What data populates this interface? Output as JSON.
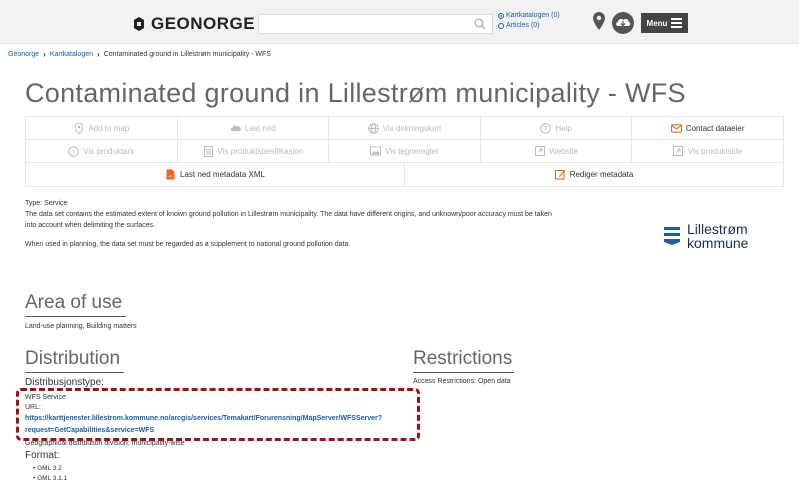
{
  "header": {
    "logo_text": "GEONORGE",
    "search_placeholder": "",
    "radio_options": [
      "Kartkatalogen (0)",
      "Articles (0)"
    ],
    "menu_label": "Menu"
  },
  "breadcrumb": [
    "Geonorge",
    "Kartkatalogen",
    "Contaminated ground in Lillestrøm municipality - WFS"
  ],
  "page_title": "Contaminated ground in Lillestrøm municipality - WFS",
  "actions": {
    "row1": [
      {
        "label": "Add to map",
        "icon": "map-pin-icon",
        "active": false
      },
      {
        "label": "Last ned",
        "icon": "cloud-download-icon",
        "active": false
      },
      {
        "label": "Vis dekningskart",
        "icon": "globe-icon",
        "active": false
      },
      {
        "label": "Help",
        "icon": "help-icon",
        "active": false
      },
      {
        "label": "Contact dataeier",
        "icon": "mail-icon",
        "active": true
      }
    ],
    "row2": [
      {
        "label": "Vis produktark",
        "icon": "info-icon",
        "active": false
      },
      {
        "label": "Vis produktspesifikasjon",
        "icon": "document-icon",
        "active": false
      },
      {
        "label": "Vis tegneregler",
        "icon": "image-icon",
        "active": false
      },
      {
        "label": "Website",
        "icon": "external-link-icon",
        "active": false
      },
      {
        "label": "Vis produktside",
        "icon": "external-link-icon",
        "active": false
      }
    ],
    "row3": [
      {
        "label": "Last ned metadata XML",
        "icon": "xml-file-icon",
        "active": true
      },
      {
        "label": "Rediger metadata",
        "icon": "edit-icon",
        "active": true
      }
    ]
  },
  "description": {
    "type": "Type: Service",
    "text": "The data set contains the estimated extent of known ground pollution in Lillestrøm municipality. The data have different origins, and unknown/poor accuracy must be taken into account when delimiting the surfaces.",
    "planning_note": "When used in planning, the data set must be regarded as a supplement to national ground pollution data."
  },
  "municipality": {
    "line1": "Lillestrøm",
    "line2": "kommune"
  },
  "area_of_use": {
    "heading": "Area of use",
    "text": "Land-use planning, Building matters"
  },
  "distribution": {
    "heading": "Distribution",
    "type_label": "Distribusjonstype:",
    "service": "WFS Service",
    "url_label": "URL:",
    "url_line1": "https://karttjenester.lillestrom.kommune.no/arcgis/services/Temakart/Forurensning/MapServer/WFSServer?",
    "url_line2": "request=GetCapabilities&service=WFS",
    "geo_division": "Geographical distribution division: municipality-wise",
    "format_label": "Format:",
    "formats": [
      "GML 3.2",
      "GML 3.1.1"
    ]
  },
  "restrictions": {
    "heading": "Restrictions",
    "text": "Access Restrictions: Open data"
  },
  "colors": {
    "link": "#1a5ea8",
    "accent_orange": "#e8671e",
    "highlight": "#a31212",
    "muni_blue": "#1b2d5a"
  }
}
